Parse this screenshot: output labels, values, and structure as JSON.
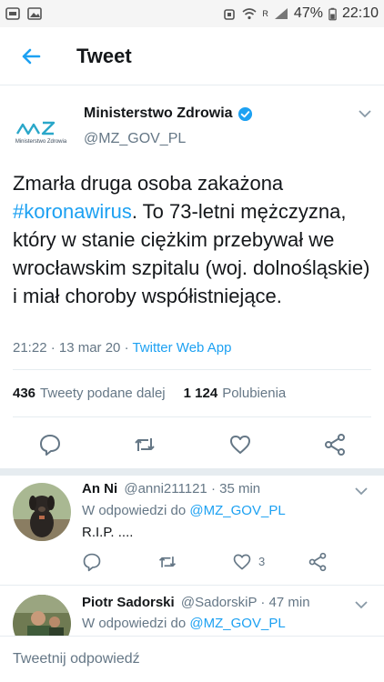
{
  "statusbar": {
    "battery": "47%",
    "time": "22:10",
    "sim": "R"
  },
  "header": {
    "title": "Tweet"
  },
  "tweet": {
    "author_name": "Ministerstwo Zdrowia",
    "author_handle": "@MZ_GOV_PL",
    "avatar_caption": "Ministerstwo Zdrowia",
    "avatar_logo_text": "MZ",
    "text_part1": "Zmarła druga osoba zakażona ",
    "hashtag": "#koronawirus",
    "text_part2": ". To 73-letni mężczyzna, który w stanie ciężkim przebywał we wrocławskim szpitalu (woj. dolnośląskie) i miał choroby współistniejące.",
    "meta_time": "21:22 · 13 mar 20 · ",
    "meta_app": "Twitter Web App",
    "retweets_count": "436",
    "retweets_label": "Tweety podane dalej",
    "likes_count": "1 124",
    "likes_label": "Polubienia"
  },
  "replies": [
    {
      "name": "An Ni",
      "handle": "@anni211121",
      "time": "· 35 min",
      "reply_to_label": "W odpowiedzi do ",
      "reply_to_handle": "@MZ_GOV_PL",
      "text": "R.I.P. ....",
      "like_count": "3"
    },
    {
      "name": "Piotr Sadorski",
      "handle": "@SadorskiP",
      "time": "· 47 min",
      "reply_to_label": "W odpowiedzi do ",
      "reply_to_handle": "@MZ_GOV_PL"
    }
  ],
  "compose": {
    "placeholder": "Tweetnij odpowiedź"
  },
  "colors": {
    "accent": "#1da1f2",
    "text": "#14171a",
    "muted": "#657786",
    "divider": "#e6ecf0"
  }
}
